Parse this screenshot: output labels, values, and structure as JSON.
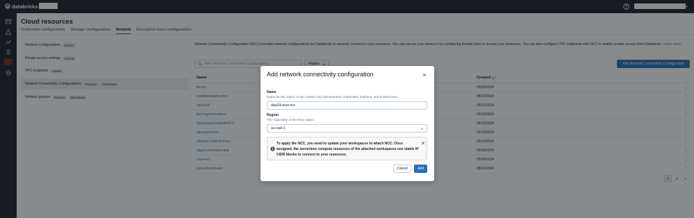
{
  "brand": {
    "name": "databricks"
  },
  "page": {
    "title": "Cloud resources"
  },
  "tabs": [
    {
      "label": "Credential configuration"
    },
    {
      "label": "Storage configuration"
    },
    {
      "label": "Network"
    },
    {
      "label": "Encryption keys configuration"
    }
  ],
  "sidebar": {
    "items": [
      {
        "label": "Network configurations",
        "chip": "Classic"
      },
      {
        "label": "Private access settings",
        "chip": "Classic"
      },
      {
        "label": "VPC endpoints",
        "chip": "Classic"
      },
      {
        "label": "Network Connectivity Configurations",
        "chip": "Preview",
        "chip2": "Serverless"
      },
      {
        "label": "Network policies",
        "chip": "Preview",
        "chip2": "Serverless"
      }
    ]
  },
  "main": {
    "description": "Network Connectivity Configuration (NCC) provides network configurations for Databricks to securely connect to your resources. You can secure your resource by configuring firewall rules to access your resources. You can also configure VPC endpoints with NCC to enable private access from Databricks.",
    "learn_more": "Learn more",
    "filter_placeholder": "Filter Network Connectivity Configurations",
    "region_filter": "Region",
    "add_button": "Add Network Connectivity Configuration",
    "columns": {
      "name": "Name",
      "created": "Created"
    },
    "rows": [
      {
        "name": "fis-ncc",
        "created": "05/25/2024"
      },
      {
        "name": "matthew-kuehn-test",
        "created": "05/23/2024"
      },
      {
        "name": "ram-test",
        "created": "05/22/2024"
      },
      {
        "name": "test-ingercia-onenv",
        "created": "05/20/2024"
      },
      {
        "name": "ServerlessComputeNCC",
        "created": "05/16/2024"
      },
      {
        "name": "davegeyertest",
        "created": "05/15/2024"
      },
      {
        "name": "clement-redshift-tf-ncc",
        "created": "05/14/2024"
      },
      {
        "name": "dagm-serverless-test",
        "created": "05/09/2024"
      },
      {
        "name": "zsun-ncc",
        "created": "05/09/2024"
      },
      {
        "name": "joel-network-aws",
        "created": "05/02/2024"
      }
    ],
    "pagination": {
      "pages": [
        "1",
        "2"
      ],
      "current": "1"
    }
  },
  "modal": {
    "title": "Add network connectivity configuration",
    "name_label": "Name",
    "name_hint": "Name for the object. It can contain only alphanumeric characters, hyphens, and underscores.",
    "name_value": "dais24-aoai-ncc",
    "region_label": "Region",
    "region_hint": "The regionality of the NCC object",
    "region_value": "us-east-1",
    "alert": "To apply the NCC, you need to update your workspaces to attach NCC. Once assigned, the serverless compute resources of the attached workspaces use stable IP CIDR blocks to connect to your resources.",
    "cancel_label": "Cancel",
    "add_label": "Add"
  },
  "colors": {
    "accent": "#2272b4",
    "nav_bg": "#1b2129",
    "active_rail": "#ff3621"
  }
}
